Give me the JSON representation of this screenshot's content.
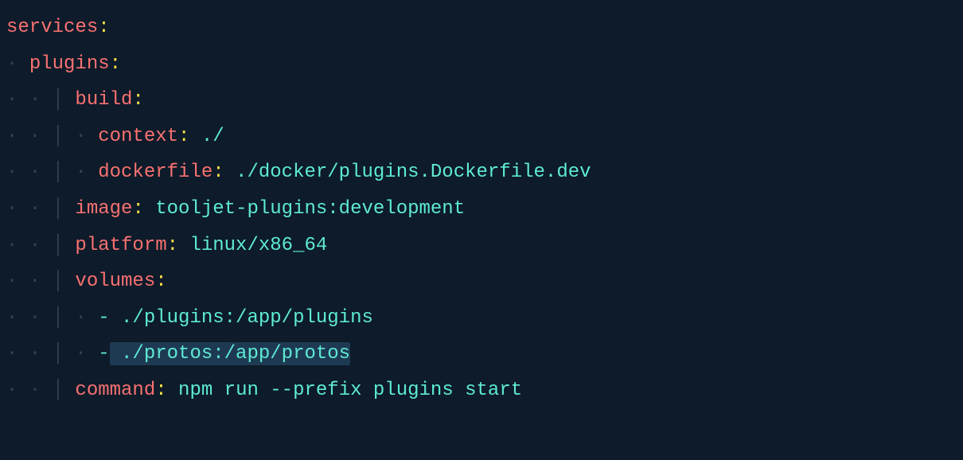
{
  "code": {
    "line1": {
      "key": "services",
      "colon": ":"
    },
    "line2": {
      "indent": "· ",
      "key": "plugins",
      "colon": ":"
    },
    "line3": {
      "indent": "· · │ ",
      "key": "build",
      "colon": ":"
    },
    "line4": {
      "indent": "· · │ · ",
      "key": "context",
      "colon": ":",
      "value": " ./"
    },
    "line5": {
      "indent": "· · │ · ",
      "key": "dockerfile",
      "colon": ":",
      "value": " ./docker/plugins.Dockerfile.dev"
    },
    "line6": {
      "indent": "· · │ ",
      "key": "image",
      "colon": ":",
      "value": " tooljet-plugins:development"
    },
    "line7": {
      "indent": "· · │ ",
      "key": "platform",
      "colon": ":",
      "value": " linux/x86_64"
    },
    "line8": {
      "indent": "· · │ ",
      "key": "volumes",
      "colon": ":"
    },
    "line9": {
      "indent": "· · │ · ",
      "dash": "-",
      "value": " ./plugins:/app/plugins"
    },
    "line10": {
      "indent": "· · │ · ",
      "dash": "-",
      "value_highlighted": " ./protos:/app/protos"
    },
    "line11": {
      "indent": "· · │ ",
      "key": "command",
      "colon": ":",
      "value": " npm run --prefix plugins start"
    }
  }
}
